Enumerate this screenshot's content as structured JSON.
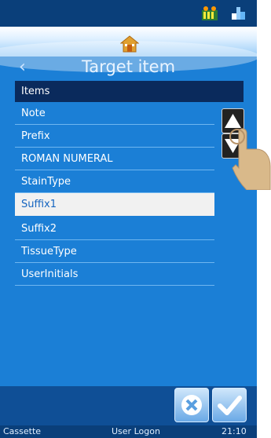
{
  "header": {
    "title": "Target item",
    "status_icons": [
      "printer-status-icon",
      "network-status-icon"
    ]
  },
  "list": {
    "header_label": "Items",
    "items": [
      {
        "label": "Note"
      },
      {
        "label": "Prefix"
      },
      {
        "label": "ROMAN NUMERAL"
      },
      {
        "label": "StainType"
      },
      {
        "label": "Suffix1",
        "selected": true
      },
      {
        "label": "Suffix2"
      },
      {
        "label": "TissueType"
      },
      {
        "label": "UserInitials"
      }
    ]
  },
  "footer": {
    "left": "Cassette",
    "center": "User Logon",
    "time": "21:10"
  },
  "buttons": {
    "cancel": "cancel-icon",
    "confirm": "check-icon"
  },
  "colors": {
    "background": "#1b7fd6",
    "dark": "#0a3f7a",
    "list_header": "#0a2a5c",
    "selected_text": "#1565c0"
  }
}
